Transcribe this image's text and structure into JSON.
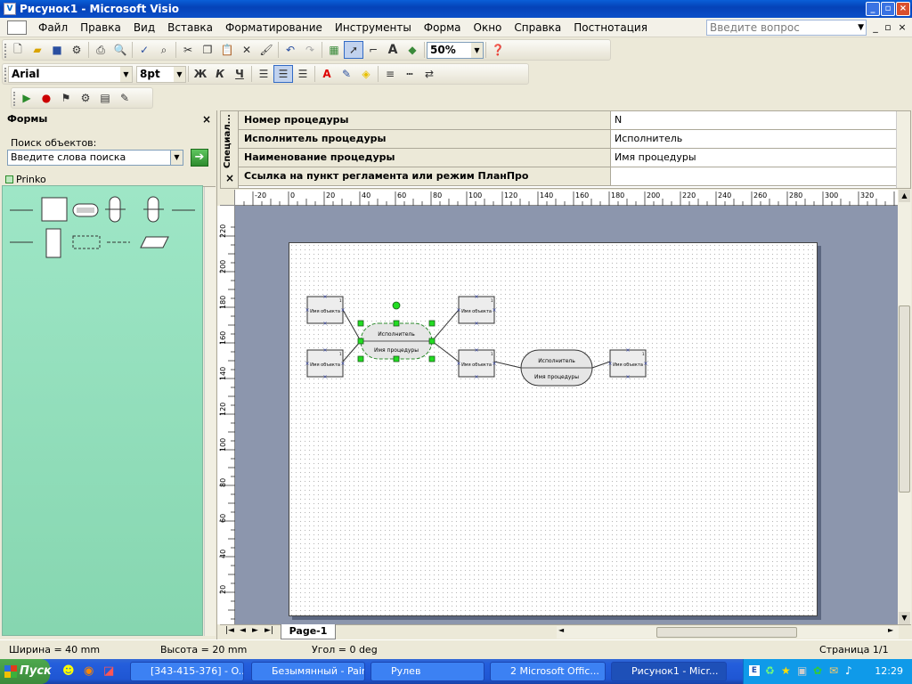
{
  "window": {
    "title": "Рисунок1 - Microsoft Visio",
    "controls": [
      "_",
      "▫",
      "×"
    ]
  },
  "menu": {
    "items": [
      "Файл",
      "Правка",
      "Вид",
      "Вставка",
      "Форматирование",
      "Инструменты",
      "Форма",
      "Окно",
      "Справка",
      "Постнотация"
    ],
    "ask_placeholder": "Введите вопрос"
  },
  "toolbar": {
    "zoom": "50%",
    "font": "Arial",
    "size": "8pt",
    "bold": "Ж",
    "italic": "К",
    "underline": "Ч"
  },
  "shapes": {
    "title": "Формы",
    "search_label": "Поиск объектов:",
    "search_placeholder": "Введите слова поиска",
    "stencil": "Prinko"
  },
  "shape_data": {
    "side_label": "Специал...",
    "rows": [
      {
        "label": "Номер процедуры",
        "value": "N"
      },
      {
        "label": "Исполнитель процедуры",
        "value": "Исполнитель"
      },
      {
        "label": "Наименование процедуры",
        "value": "Имя процедуры"
      },
      {
        "label": "Ссылка на пункт регламента или режим ПланПро",
        "value": ""
      }
    ]
  },
  "ruler": {
    "h": [
      "-20",
      "0",
      "20",
      "40",
      "60",
      "80",
      "100",
      "120",
      "140",
      "160",
      "180",
      "200",
      "220",
      "240",
      "260",
      "280",
      "300",
      "320"
    ],
    "v": [
      "220",
      "200",
      "180",
      "160",
      "140",
      "120",
      "100",
      "80",
      "60",
      "40",
      "20"
    ]
  },
  "diagram": {
    "object_label": "Имя объекта",
    "proc_performer": "Исполнитель",
    "proc_name": "Имя процедуры",
    "corner_mark": "1"
  },
  "page_tab": "Page-1",
  "status": {
    "width": "Ширина = 40 mm",
    "height": "Высота = 20 mm",
    "angle": "Угол = 0 deg",
    "page": "Страница 1/1"
  },
  "taskbar": {
    "start": "Пуск",
    "tasks": [
      "[343-415-376] - O...",
      "Безымянный - Paint",
      "Рулев",
      "2 Microsoft Offic...",
      "Рисунок1 - Micr..."
    ],
    "clock": "12:29"
  }
}
